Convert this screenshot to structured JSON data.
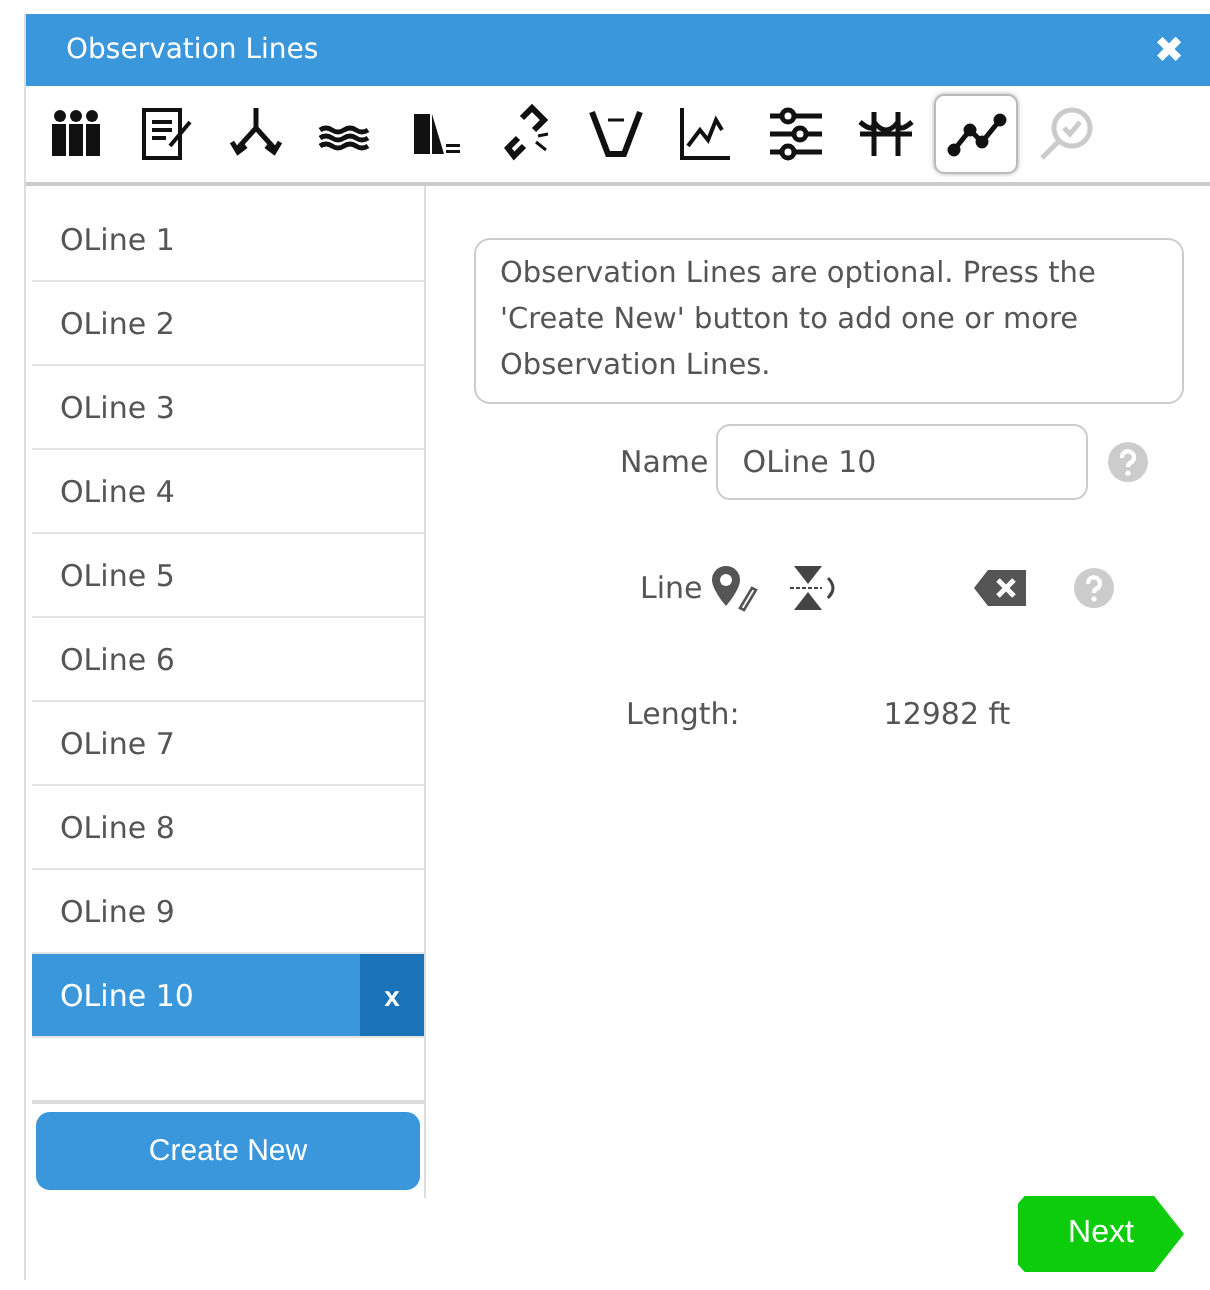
{
  "window": {
    "title": "Observation Lines",
    "close": "✖"
  },
  "toolbar": [
    {
      "selected": false,
      "disabled": false
    },
    {
      "selected": false,
      "disabled": false
    },
    {
      "selected": false,
      "disabled": false
    },
    {
      "selected": false,
      "disabled": false
    },
    {
      "selected": false,
      "disabled": false
    },
    {
      "selected": false,
      "disabled": false
    },
    {
      "selected": false,
      "disabled": false
    },
    {
      "selected": false,
      "disabled": false
    },
    {
      "selected": false,
      "disabled": false
    },
    {
      "selected": false,
      "disabled": false
    },
    {
      "selected": true,
      "disabled": false
    },
    {
      "selected": false,
      "disabled": true
    }
  ],
  "sidebar": {
    "items": [
      {
        "label": "OLine 1",
        "selected": false
      },
      {
        "label": "OLine 2",
        "selected": false
      },
      {
        "label": "OLine 3",
        "selected": false
      },
      {
        "label": "OLine 4",
        "selected": false
      },
      {
        "label": "OLine 5",
        "selected": false
      },
      {
        "label": "OLine 6",
        "selected": false
      },
      {
        "label": "OLine 7",
        "selected": false
      },
      {
        "label": "OLine 8",
        "selected": false
      },
      {
        "label": "OLine 9",
        "selected": false
      },
      {
        "label": "OLine 10",
        "selected": true,
        "delete": "x"
      }
    ],
    "create_button": "Create New"
  },
  "info": "Observation Lines are optional. Press the 'Create New' button to add one or more Observation Lines.",
  "name_field": {
    "label": "Name",
    "value": "OLine 10"
  },
  "line_row": {
    "label": "Line"
  },
  "length": {
    "label": "Length:",
    "value": "12982 ft"
  },
  "next_button": "Next"
}
